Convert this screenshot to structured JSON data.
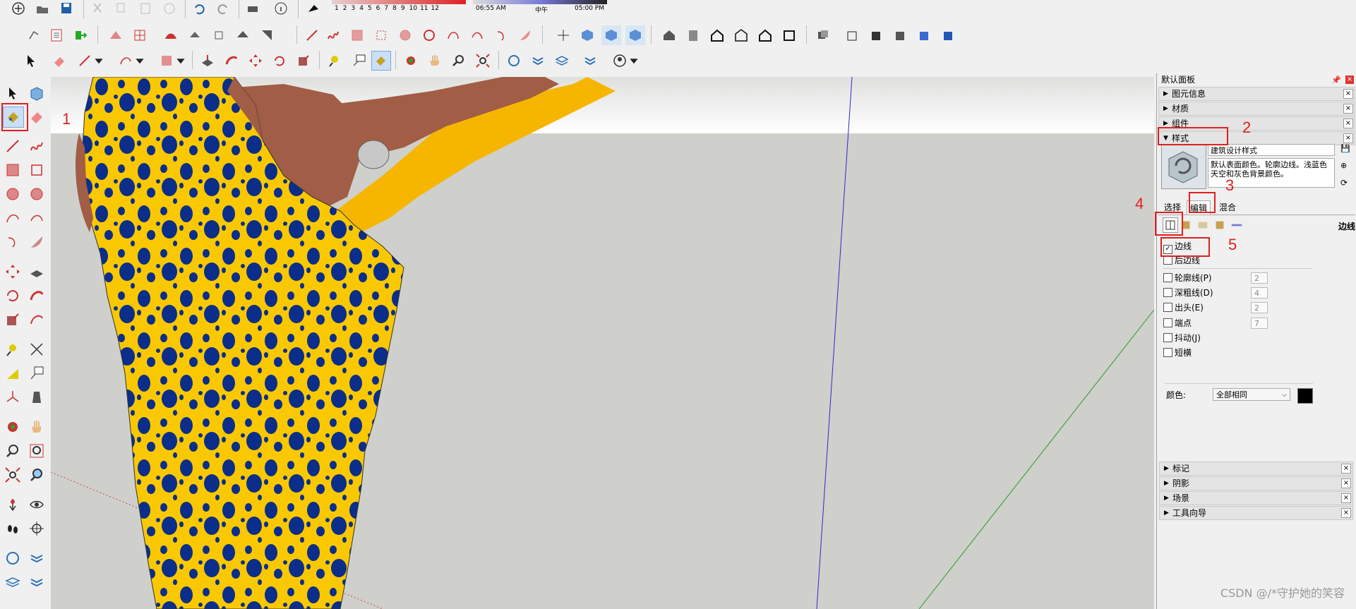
{
  "time_bar": {
    "months": [
      "1",
      "2",
      "3",
      "4",
      "5",
      "6",
      "7",
      "8",
      "9",
      "10",
      "11",
      "12"
    ],
    "sunrise": "06:55 AM",
    "noon": "中午",
    "sunset": "05:00 PM"
  },
  "panel": {
    "title": "默认面板",
    "sections_top": [
      {
        "label": "图元信息",
        "expanded": false
      },
      {
        "label": "材质",
        "expanded": false
      },
      {
        "label": "组件",
        "expanded": false
      },
      {
        "label": "样式",
        "expanded": true
      }
    ],
    "style": {
      "name": "建筑设计样式",
      "description": "默认表面颜色。轮廓边线。浅蓝色天空和灰色背景颜色。",
      "tabs": [
        "选择",
        "编辑",
        "混合"
      ],
      "active_tab": "编辑",
      "edge_heading": "边线",
      "edge_options": [
        {
          "label": "边线",
          "checked": true
        },
        {
          "label": "后边线",
          "checked": false
        },
        {
          "label": "轮廓线(P)",
          "checked": false,
          "value": "2"
        },
        {
          "label": "深粗线(D)",
          "checked": false,
          "value": "4"
        },
        {
          "label": "出头(E)",
          "checked": false,
          "value": "2"
        },
        {
          "label": "端点",
          "checked": false,
          "value": "7"
        },
        {
          "label": "抖动(J)",
          "checked": false
        },
        {
          "label": "短横",
          "checked": false
        }
      ],
      "color_label": "颜色:",
      "color_select": "全部相同",
      "color_swatch": "#000000"
    },
    "sections_bottom": [
      {
        "label": "标记"
      },
      {
        "label": "阴影"
      },
      {
        "label": "场景"
      },
      {
        "label": "工具向导"
      }
    ]
  },
  "annotations": [
    "1",
    "2",
    "3",
    "4",
    "5"
  ],
  "annotation_color": "#e02020",
  "watermark": "CSDN @/*守护她的笑容"
}
